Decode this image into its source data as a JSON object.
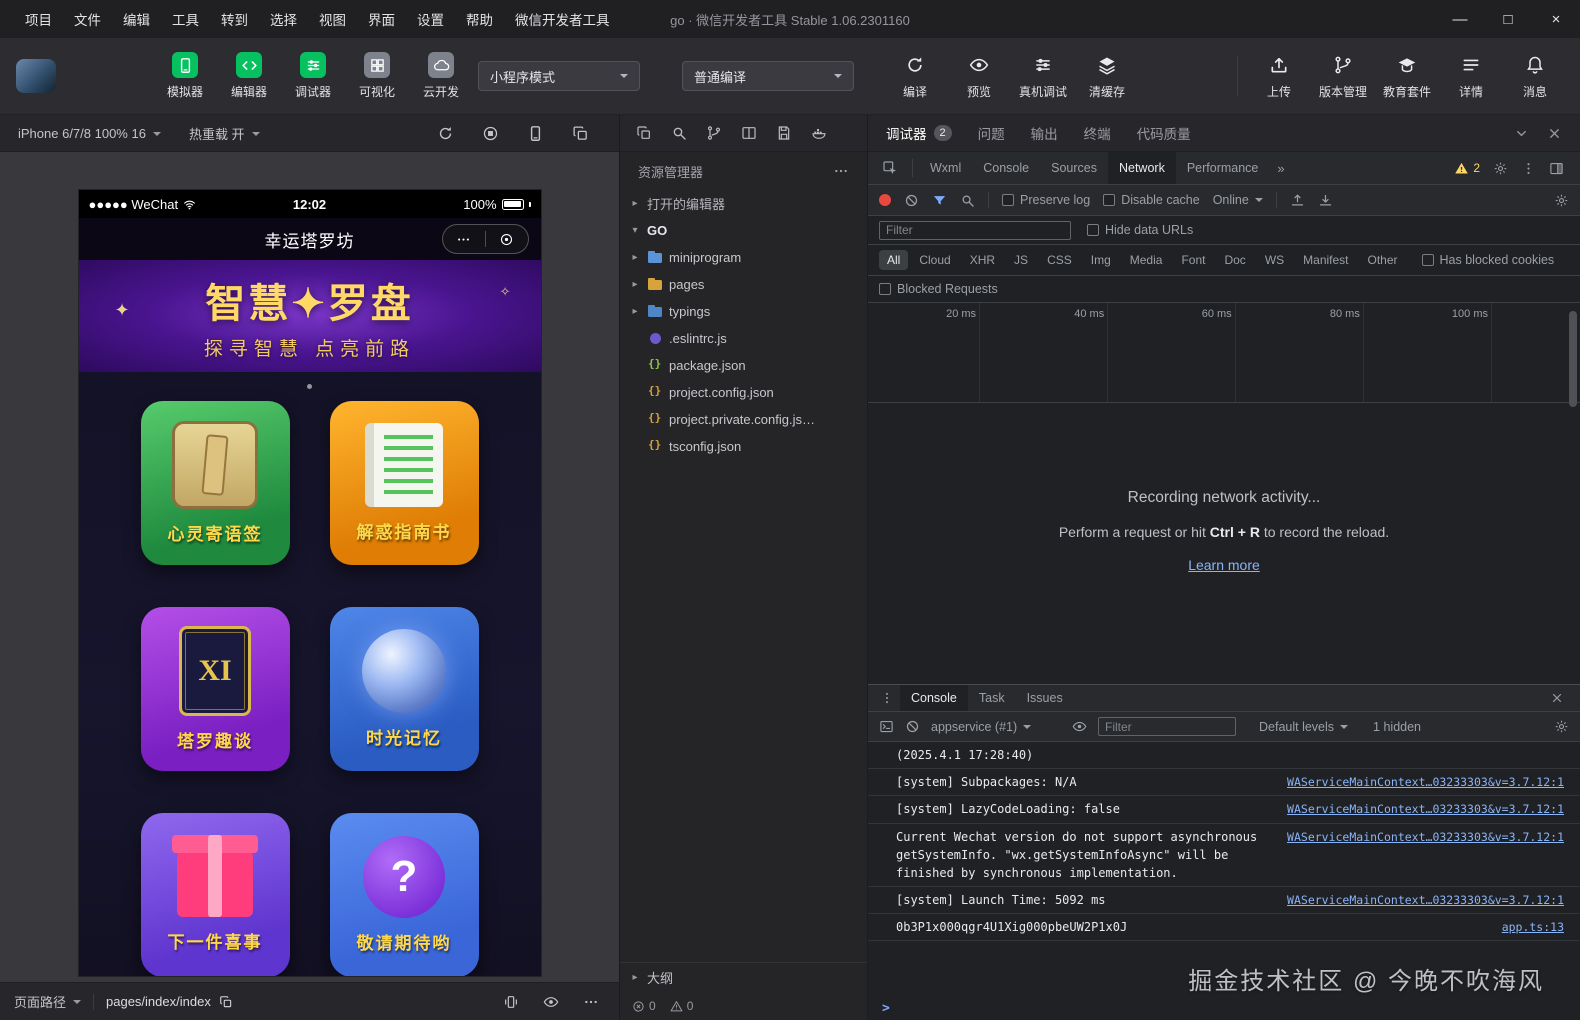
{
  "titlebar": {
    "menus": [
      "项目",
      "文件",
      "编辑",
      "工具",
      "转到",
      "选择",
      "视图",
      "界面",
      "设置",
      "帮助",
      "微信开发者工具"
    ],
    "title": "go · 微信开发者工具 Stable 1.06.2301160",
    "window": {
      "minimize": "—",
      "maximize": "□",
      "close": "×"
    }
  },
  "toolbar": {
    "tools": [
      {
        "label": "模拟器",
        "icon": "phone",
        "style": "green"
      },
      {
        "label": "编辑器",
        "icon": "code",
        "style": "green"
      },
      {
        "label": "调试器",
        "icon": "tune",
        "style": "green"
      },
      {
        "label": "可视化",
        "icon": "grid",
        "style": "gray"
      },
      {
        "label": "云开发",
        "icon": "cloud",
        "style": "gray"
      }
    ],
    "mode_select": "小程序模式",
    "compile_select": "普通编译",
    "actions": [
      {
        "label": "编译",
        "icon": "refresh",
        "style": "plain"
      },
      {
        "label": "预览",
        "icon": "eye",
        "style": "plain"
      },
      {
        "label": "真机调试",
        "icon": "tune",
        "style": "plain"
      },
      {
        "label": "清缓存",
        "icon": "layers",
        "style": "plain"
      }
    ],
    "right_actions": [
      {
        "label": "上传",
        "icon": "upload",
        "style": "plain"
      },
      {
        "label": "版本管理",
        "icon": "branch",
        "style": "plain"
      },
      {
        "label": "教育套件",
        "icon": "gradcap",
        "style": "plain"
      },
      {
        "label": "详情",
        "icon": "list",
        "style": "plain"
      },
      {
        "label": "消息",
        "icon": "bell",
        "style": "plain"
      }
    ]
  },
  "device_bar": {
    "device": "iPhone 6/7/8 100% 16",
    "hot_reload": "热重载 开"
  },
  "simulator": {
    "status": {
      "carrier": "●●●●● WeChat",
      "time": "12:02",
      "battery": "100%"
    },
    "nav_title": "幸运塔罗坊",
    "banner": {
      "title": "智慧✦罗盘",
      "subtitle": "探寻智慧 点亮前路"
    },
    "cards": [
      {
        "label": "心灵寄语签",
        "theme": "green",
        "icon": "stick",
        "icon_text": ""
      },
      {
        "label": "解惑指南书",
        "theme": "orange",
        "icon": "book",
        "icon_text": ""
      },
      {
        "label": "塔罗趣谈",
        "theme": "purple",
        "icon": "tarot",
        "icon_text": "XI"
      },
      {
        "label": "时光记忆",
        "theme": "blue",
        "icon": "sphere",
        "icon_text": ""
      },
      {
        "label": "下一件喜事",
        "theme": "violet",
        "icon": "gift",
        "icon_text": ""
      },
      {
        "label": "敬请期待哟",
        "theme": "skyblue",
        "icon": "question",
        "icon_text": "?"
      }
    ],
    "foot": {
      "path_label": "页面路径",
      "path_value": "pages/index/index"
    }
  },
  "explorer": {
    "title": "资源管理器",
    "open_editors": "打开的编辑器",
    "root": "GO",
    "items": [
      {
        "name": "miniprogram",
        "tint": "folder-blue",
        "chev": "▸"
      },
      {
        "name": "pages",
        "tint": "folder-orange",
        "chev": "▸"
      },
      {
        "name": "typings",
        "tint": "folder-ts",
        "chev": "▸"
      },
      {
        "name": ".eslintrc.js",
        "tint": "eslint",
        "chev": ""
      },
      {
        "name": "package.json",
        "tint": "npm",
        "chev": ""
      },
      {
        "name": "project.config.json",
        "tint": "json",
        "chev": ""
      },
      {
        "name": "project.private.config.js…",
        "tint": "json",
        "chev": ""
      },
      {
        "name": "tsconfig.json",
        "tint": "json",
        "chev": ""
      }
    ],
    "outline": "大纲",
    "errors": "0",
    "warnings": "0"
  },
  "debugger_panel": {
    "tabs": [
      {
        "label": "调试器",
        "badge": "2",
        "state": "active"
      },
      {
        "label": "问题",
        "badge": "",
        "state": ""
      },
      {
        "label": "输出",
        "badge": "",
        "state": ""
      },
      {
        "label": "终端",
        "badge": "",
        "state": ""
      },
      {
        "label": "代码质量",
        "badge": "",
        "state": ""
      }
    ]
  },
  "devtools": {
    "tabs": [
      {
        "label": "Wxml",
        "state": ""
      },
      {
        "label": "Console",
        "state": ""
      },
      {
        "label": "Sources",
        "state": ""
      },
      {
        "label": "Network",
        "state": "active"
      },
      {
        "label": "Performance",
        "state": ""
      }
    ],
    "more_tabs": "»",
    "warning_count": "2",
    "network": {
      "preserve_log": "Preserve log",
      "disable_cache": "Disable cache",
      "throttling": "Online",
      "filter_placeholder": "Filter",
      "hide_data_urls": "Hide data URLs",
      "pills": [
        {
          "label": "All",
          "state": "active"
        },
        {
          "label": "Cloud",
          "state": ""
        },
        {
          "label": "XHR",
          "state": ""
        },
        {
          "label": "JS",
          "state": ""
        },
        {
          "label": "CSS",
          "state": ""
        },
        {
          "label": "Img",
          "state": ""
        },
        {
          "label": "Media",
          "state": ""
        },
        {
          "label": "Font",
          "state": ""
        },
        {
          "label": "Doc",
          "state": ""
        },
        {
          "label": "WS",
          "state": ""
        },
        {
          "label": "Manifest",
          "state": ""
        },
        {
          "label": "Other",
          "state": ""
        }
      ],
      "has_blocked_cookies": "Has blocked cookies",
      "blocked_requests": "Blocked Requests",
      "timeline_ticks": [
        "20 ms",
        "40 ms",
        "60 ms",
        "80 ms",
        "100 ms"
      ],
      "empty_title": "Recording network activity...",
      "hint_prefix": "Perform a request or hit ",
      "hint_key": "Ctrl + R",
      "hint_suffix": " to record the reload.",
      "learn_more": "Learn more"
    },
    "console": {
      "tabs": [
        {
          "label": "Console",
          "state": "active"
        },
        {
          "label": "Task",
          "state": ""
        },
        {
          "label": "Issues",
          "state": ""
        }
      ],
      "context": "appservice (#1)",
      "filter_placeholder": "Filter",
      "levels_label": "Default levels",
      "hidden_label": "1 hidden",
      "entries": [
        {
          "text": "(2025.4.1 17:28:40)",
          "link": ""
        },
        {
          "text": "[system] Subpackages: N/A",
          "link": "WAServiceMainContext…03233303&v=3.7.12:1"
        },
        {
          "text": "[system] LazyCodeLoading: false",
          "link": "WAServiceMainContext…03233303&v=3.7.12:1"
        },
        {
          "text": "Current Wechat version do not support asynchronous getSystemInfo. \"wx.getSystemInfoAsync\" will be finished by synchronous implementation.",
          "link": "WAServiceMainContext…03233303&v=3.7.12:1"
        },
        {
          "text": "[system] Launch Time: 5092 ms",
          "link": "WAServiceMainContext…03233303&v=3.7.12:1"
        },
        {
          "text": "0b3P1x000qgr4U1Xig000pbeUW2P1x0J",
          "link": "app.ts:13"
        }
      ]
    }
  },
  "watermark": "掘金技术社区 @ 今晚不吹海风"
}
